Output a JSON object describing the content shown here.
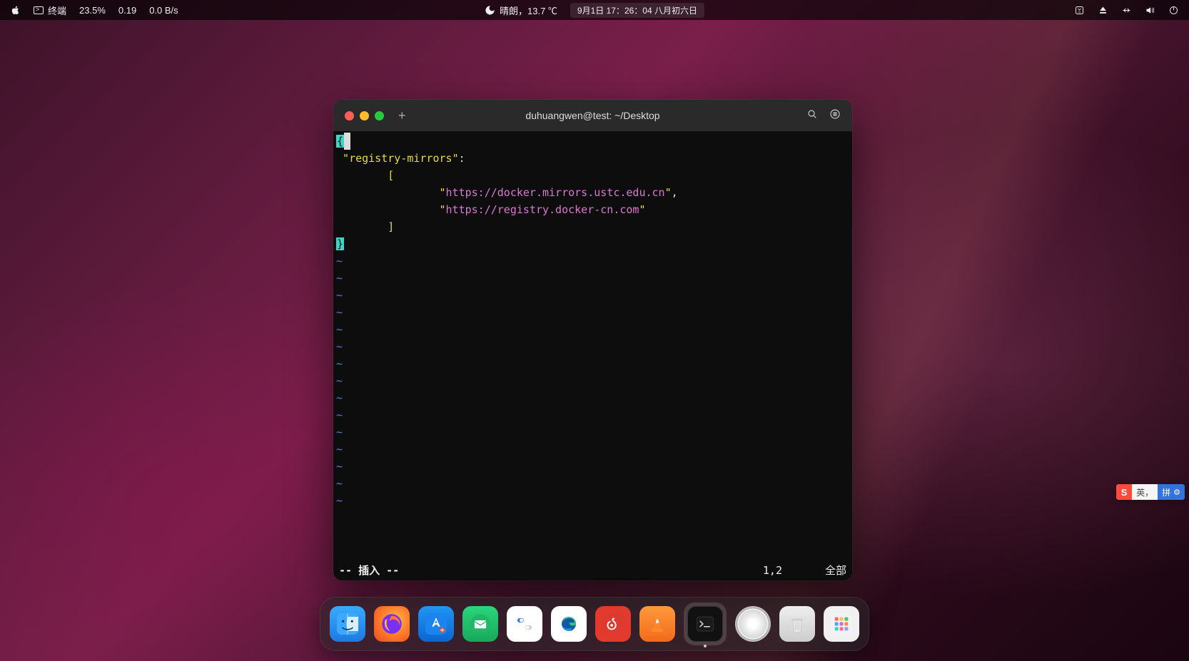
{
  "menubar": {
    "app_name": "终端",
    "cpu_pct": "23.5%",
    "load": "0.19",
    "net": "0.0 B/s",
    "weather": "晴朗，13.7 ℃",
    "datetime": "9月1日  17：26：04   八月初六日"
  },
  "terminal": {
    "title": "duhuangwen@test: ~/Desktop",
    "content": {
      "key": "registry-mirrors",
      "urls": [
        "https://docker.mirrors.ustc.edu.cn",
        "https://registry.docker-cn.com"
      ]
    },
    "status": {
      "mode": "-- 插入 --",
      "position": "1,2",
      "percent": "全部"
    }
  },
  "dock": {
    "items": [
      {
        "name": "finder"
      },
      {
        "name": "firefox"
      },
      {
        "name": "appstore"
      },
      {
        "name": "mail"
      },
      {
        "name": "settings"
      },
      {
        "name": "edge"
      },
      {
        "name": "netease-music"
      },
      {
        "name": "vlc"
      },
      {
        "name": "terminal",
        "active": true
      },
      {
        "name": "disc"
      },
      {
        "name": "trash"
      },
      {
        "name": "launchpad"
      }
    ]
  },
  "ime": {
    "logo": "S",
    "lang": "英",
    "sep": "，",
    "mode": "拼"
  }
}
